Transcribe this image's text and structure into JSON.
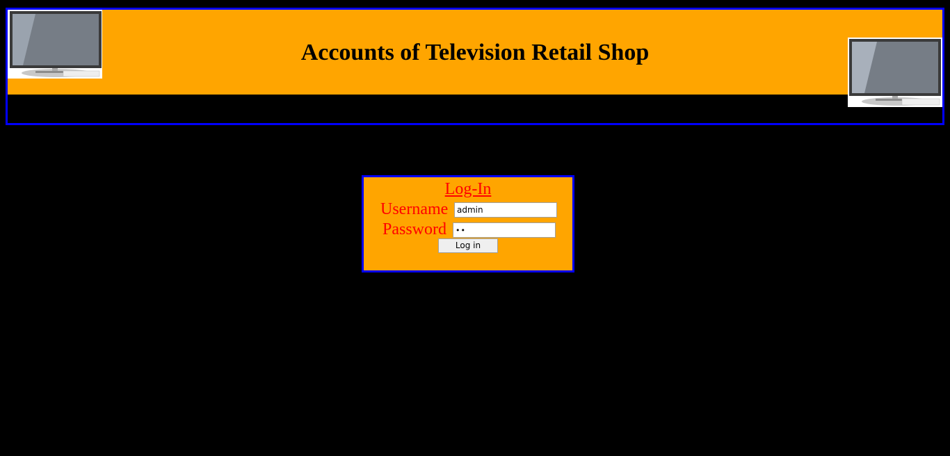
{
  "header": {
    "title": "Accounts of Television Retail Shop",
    "left_image_icon": "television-icon",
    "right_image_icon": "television-icon"
  },
  "login": {
    "title": "Log-In",
    "username_label": "Username",
    "password_label": "Password",
    "username_value": "admin",
    "password_value": "ab",
    "button_label": "Log in"
  },
  "colors": {
    "background": "#000000",
    "banner": "#ffa500",
    "border": "#0000ff",
    "label_text": "#ff0000"
  }
}
